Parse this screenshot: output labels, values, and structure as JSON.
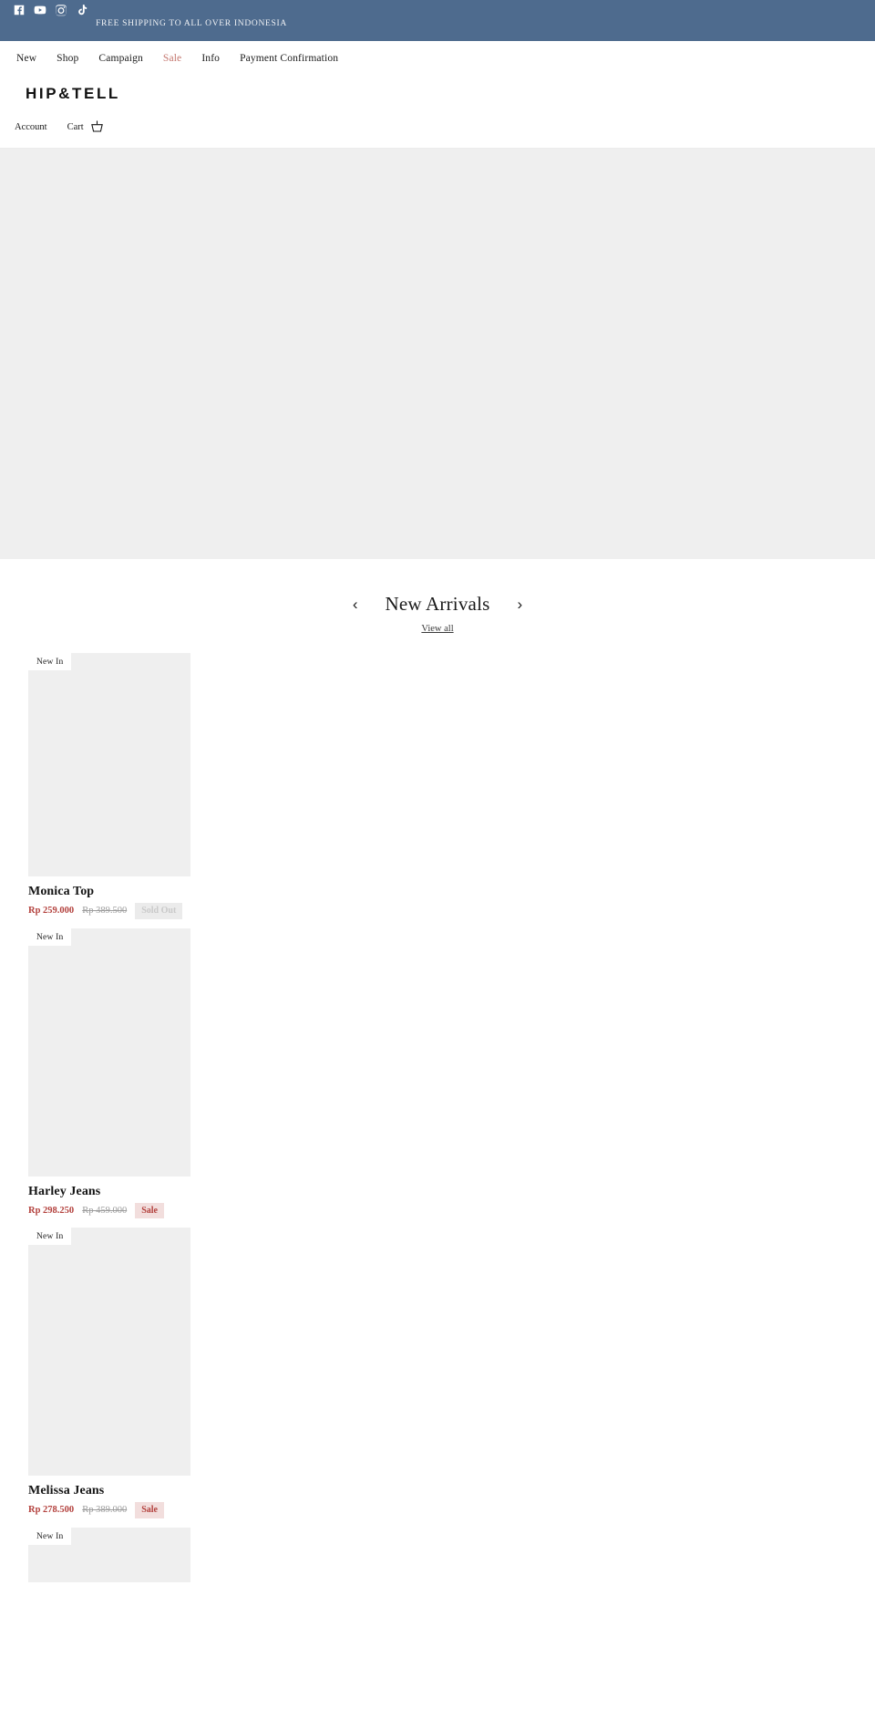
{
  "topbar": {
    "announcement": "FREE SHIPPING TO ALL OVER INDONESIA",
    "background_color": "#4e6b8e",
    "social": [
      {
        "name": "facebook-icon",
        "label": "Facebook"
      },
      {
        "name": "youtube-icon",
        "label": "YouTube"
      },
      {
        "name": "instagram-icon",
        "label": "Instagram"
      },
      {
        "name": "tiktok-icon",
        "label": "TikTok"
      }
    ]
  },
  "header": {
    "brand": "HIP&TELL",
    "nav": [
      {
        "label": "New",
        "highlight": false
      },
      {
        "label": "Shop",
        "highlight": false
      },
      {
        "label": "Campaign",
        "highlight": false
      },
      {
        "label": "Sale",
        "highlight": true
      },
      {
        "label": "Info",
        "highlight": false
      },
      {
        "label": "Payment Confirmation",
        "highlight": false
      }
    ],
    "sale_color": "#c4766e",
    "account_label": "Account",
    "cart_label": "Cart",
    "cart_icon": "shopping-basket-icon"
  },
  "hero": {
    "placeholder_color": "#efefef"
  },
  "arrivals": {
    "title": "New Arrivals",
    "prev_arrow": "‹",
    "next_arrow": "›",
    "view_all": "View all",
    "products": [
      {
        "badge_top": "New In",
        "name": "Monica Top",
        "price_now": "Rp 259.000",
        "price_was": "Rp 389.500",
        "status_badge": "Sold Out",
        "status_type": "soldout"
      },
      {
        "badge_top": "New In",
        "name": "Harley Jeans",
        "price_now": "Rp 298.250",
        "price_was": "Rp 459.000",
        "status_badge": "Sale",
        "status_type": "sale"
      },
      {
        "badge_top": "New In",
        "name": "Melissa Jeans",
        "price_now": "Rp 278.500",
        "price_was": "Rp 389.000",
        "status_badge": "Sale",
        "status_type": "sale"
      },
      {
        "badge_top": "New In",
        "name": "",
        "price_now": "",
        "price_was": "",
        "status_badge": "",
        "status_type": "none"
      }
    ]
  },
  "colors": {
    "accent_red": "#b3413d",
    "sale_badge_bg": "#f2dedd",
    "soldout_badge_bg": "#ebebeb",
    "placeholder_gray": "#efefef"
  }
}
